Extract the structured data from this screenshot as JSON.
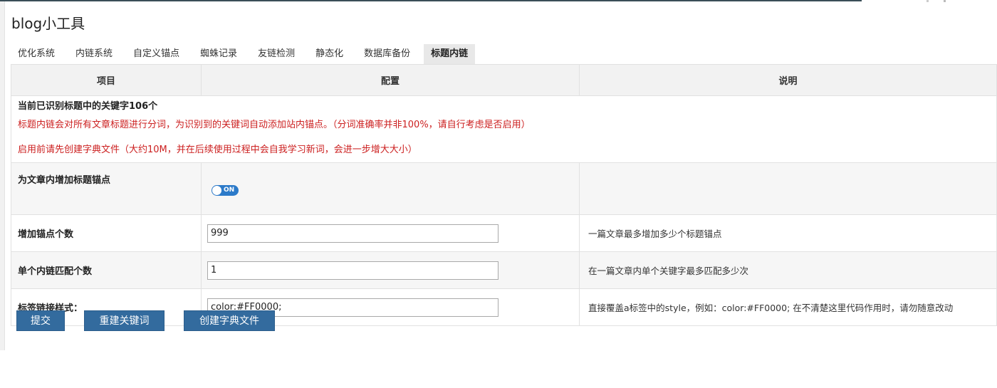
{
  "page_title": "blog小工具",
  "tabs": [
    {
      "label": "优化系统"
    },
    {
      "label": "内链系统"
    },
    {
      "label": "自定义锚点"
    },
    {
      "label": "蜘蛛记录"
    },
    {
      "label": "友链检测"
    },
    {
      "label": "静态化"
    },
    {
      "label": "数据库备份"
    },
    {
      "label": "标题内链"
    }
  ],
  "active_tab": "标题内链",
  "table": {
    "headers": [
      "项目",
      "配置",
      "说明"
    ],
    "info": {
      "title": "当前已识别标题中的关键字106个",
      "note1": "标题内链会对所有文章标题进行分词，为识别到的关键词自动添加站内锚点。（分词准确率并非100%，请自行考虑是否启用）",
      "note2": "启用前请先创建字典文件（大约10M，并在后续使用过程中会自我学习新词，会进一步增大大小）"
    },
    "rows": [
      {
        "label": "为文章内增加标题锚点",
        "toggle": "ON",
        "toggle_state": true,
        "desc": ""
      },
      {
        "label": "增加锚点个数",
        "value": "999",
        "desc": "一篇文章最多增加多少个标题锚点"
      },
      {
        "label": "单个内链匹配个数",
        "value": "1",
        "desc": "在一篇文章内单个关键字最多匹配多少次"
      },
      {
        "label": "标签链接样式：",
        "value": "color:#FF0000;",
        "desc": "直接覆盖a标签中的style，例如：color:#FF0000; 在不清楚这里代码作用时，请勿随意改动"
      }
    ]
  },
  "buttons": {
    "submit": "提交",
    "rebuild": "重建关键词",
    "create_dict": "创建字典文件"
  },
  "colors": {
    "button_bg": "#336b9e",
    "toggle_on": "#2c7ac9",
    "warning_text": "#cc2020",
    "header_bg": "#f2f2f2"
  }
}
